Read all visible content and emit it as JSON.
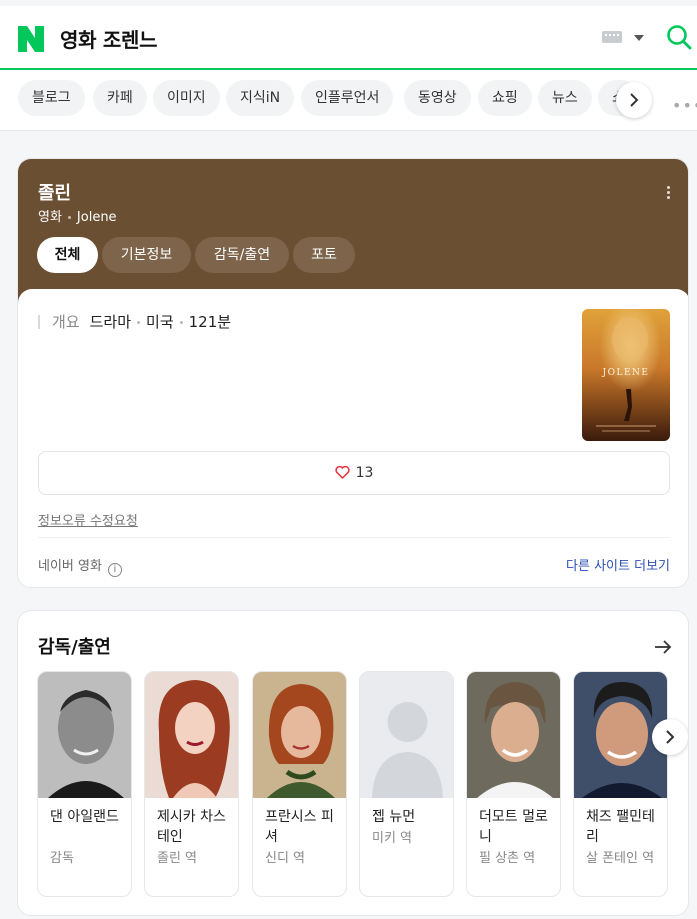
{
  "search": {
    "query": "영화 조렌느"
  },
  "tabs": [
    "블로그",
    "카페",
    "이미지",
    "지식iN",
    "인플루언서",
    "동영상",
    "쇼핑",
    "뉴스",
    "쇼"
  ],
  "movie": {
    "title": "졸린",
    "category": "영화",
    "original_title": "Jolene",
    "tabs": [
      "전체",
      "기본정보",
      "감독/출연",
      "포토"
    ],
    "overview_label": "개요",
    "genre": "드라마",
    "country": "미국",
    "runtime": "121분",
    "poster_text": "JOLENE",
    "likes": "13",
    "report_link": "정보오류 수정요청",
    "source": "네이버 영화",
    "info_icon": "i",
    "more_sites": "다른 사이트 더보기"
  },
  "cast": {
    "title": "감독/출연",
    "people": [
      {
        "name": "댄 아일랜드",
        "role": "감독"
      },
      {
        "name": "제시카 차스테인",
        "role": "졸린 역"
      },
      {
        "name": "프란시스 피셔",
        "role": "신디 역"
      },
      {
        "name": "젭 뉴먼",
        "role": "미키 역"
      },
      {
        "name": "더모트 멀로니",
        "role": "필 상촌 역"
      },
      {
        "name": "채즈 팰민테리",
        "role": "살 폰테인 역"
      }
    ]
  },
  "colors": {
    "brand_green": "#03c75a",
    "header_brown": "#6b4f32",
    "link_blue": "#2d4fb5"
  }
}
